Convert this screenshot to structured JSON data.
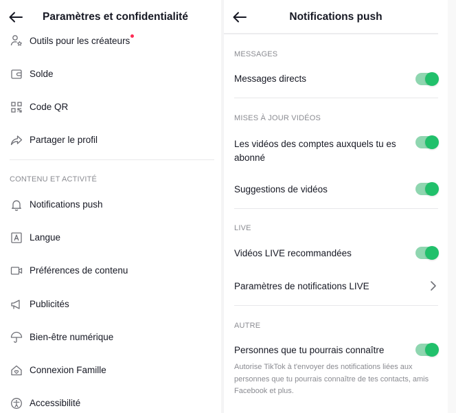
{
  "left": {
    "title": "Paramètres et confidentialité",
    "items_top": [
      {
        "label": "Outils pour les créateurs",
        "icon": "user-star-icon",
        "has_dot": true
      },
      {
        "label": "Solde",
        "icon": "wallet-icon"
      },
      {
        "label": "Code QR",
        "icon": "qr-code-icon"
      },
      {
        "label": "Partager le profil",
        "icon": "share-icon"
      }
    ],
    "section": "CONTENU ET ACTIVITÉ",
    "items": [
      {
        "label": "Notifications push",
        "icon": "bell-icon"
      },
      {
        "label": "Langue",
        "icon": "language-icon"
      },
      {
        "label": "Préférences de contenu",
        "icon": "video-camera-icon"
      },
      {
        "label": "Publicités",
        "icon": "megaphone-icon"
      },
      {
        "label": "Bien-être numérique",
        "icon": "umbrella-icon"
      },
      {
        "label": "Connexion Famille",
        "icon": "family-home-icon"
      },
      {
        "label": "Accessibilité",
        "icon": "accessibility-icon"
      }
    ]
  },
  "right": {
    "title": "Notifications push",
    "sections": {
      "messages": "MESSAGES",
      "videos": "MISES À JOUR VIDÉOS",
      "live": "LIVE",
      "other": "AUTRE"
    },
    "rows": {
      "direct_messages": {
        "label": "Messages directs",
        "on": true
      },
      "followed_videos": {
        "label": "Les vidéos des comptes auxquels tu es abonné",
        "on": true
      },
      "video_suggestions": {
        "label": "Suggestions de vidéos",
        "on": true
      },
      "live_recommended": {
        "label": "Vidéos LIVE recommandées",
        "on": true
      },
      "live_settings": {
        "label": "Paramètres de notifications LIVE"
      },
      "people_you_may_know": {
        "label": "Personnes que tu pourrais connaître",
        "on": true
      }
    },
    "note": "Autorise TikTok à t'envoyer des notifications liées aux personnes que tu pourrais connaître de tes contacts, amis Facebook et plus."
  },
  "colors": {
    "toggle_track": "#8fd6b0",
    "toggle_knob": "#21c06b",
    "notification_dot": "#fe2c55",
    "section_text": "#8a8b91"
  }
}
